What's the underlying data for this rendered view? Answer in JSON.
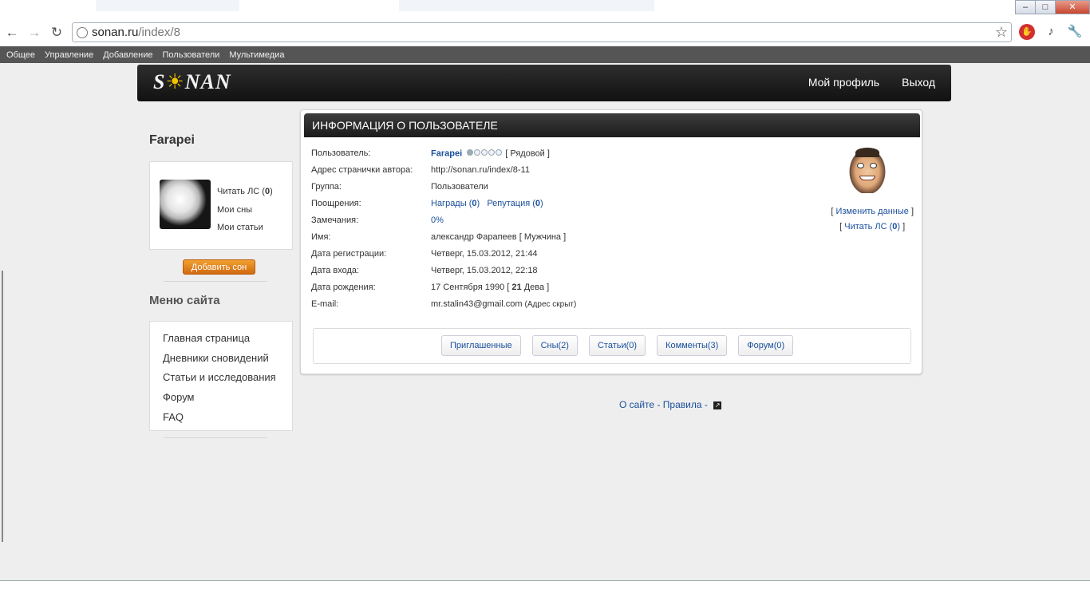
{
  "browser": {
    "url_host": "sonan.ru",
    "url_path": "/index/8",
    "window_controls": {
      "minimize": "–",
      "maximize": "□",
      "close": "✕"
    }
  },
  "admin_bar": {
    "items": [
      "Общее",
      "Управление",
      "Добавление",
      "Пользователи",
      "Мультимедиа"
    ]
  },
  "header": {
    "logo_before": "S",
    "logo_sun": "☀",
    "logo_after": "NAN",
    "nav": [
      "Мой профиль",
      "Выход"
    ]
  },
  "sidebar": {
    "username": "Farapei",
    "links": {
      "read_pm_prefix": "Читать ЛС (",
      "read_pm_count": "0",
      "read_pm_suffix": ")",
      "my_dreams": "Мои сны",
      "my_articles": "Мои статьи"
    },
    "add_dream_button": "Добавить сон",
    "menu_title": "Меню сайта",
    "menu_items": [
      "Главная страница",
      "Дневники сновидений",
      "Статьи и исследования",
      "Форум",
      "FAQ"
    ]
  },
  "profile": {
    "title": "ИНФОРМАЦИЯ О ПОЛЬЗОВАТЕЛЕ",
    "labels": {
      "user": "Пользователь:",
      "page_address": "Адрес странички автора:",
      "group": "Группа:",
      "rewards": "Поощрения:",
      "remarks": "Замечания:",
      "name": "Имя:",
      "registered": "Дата регистрации:",
      "last_login": "Дата входа:",
      "birthday": "Дата рождения:",
      "email": "E-mail:"
    },
    "values": {
      "user_name": "Farapei",
      "rank": "[ Рядовой ]",
      "rank_level": 1,
      "rank_max": 5,
      "page_address": "http://sonan.ru/index/8-11",
      "group": "Пользователи",
      "awards_prefix": "Награды (",
      "awards_count": "0",
      "reputation_prefix": "Репутация (",
      "reputation_count": "0",
      "close_paren": ")",
      "remarks": "0%",
      "name": "александр Фарапеев",
      "gender": "[ Мужчина ]",
      "registered": "Четверг, 15.03.2012, 21:44",
      "last_login": "Четверг, 15.03.2012, 22:18",
      "birthday": "17 Сентября 1990",
      "bracket_open": "[",
      "age": "21",
      "zodiac": "Дева ]",
      "email": "mr.stalin43@gmail.com",
      "email_note": "(Адрес скрыт)"
    },
    "right_links": {
      "edit": "Изменить данные",
      "read_pm_prefix": "Читать ЛС (",
      "read_pm_count": "0",
      "read_pm_suffix": ")",
      "bracket_open": "[",
      "bracket_close": "]"
    },
    "tabs": [
      "Приглашенные",
      "Сны(2)",
      "Статьи(0)",
      "Комменты(3)",
      "Форум(0)"
    ]
  },
  "footer": {
    "about": "О сайте",
    "sep": "-",
    "rules": "Правила",
    "sep2": "-"
  }
}
